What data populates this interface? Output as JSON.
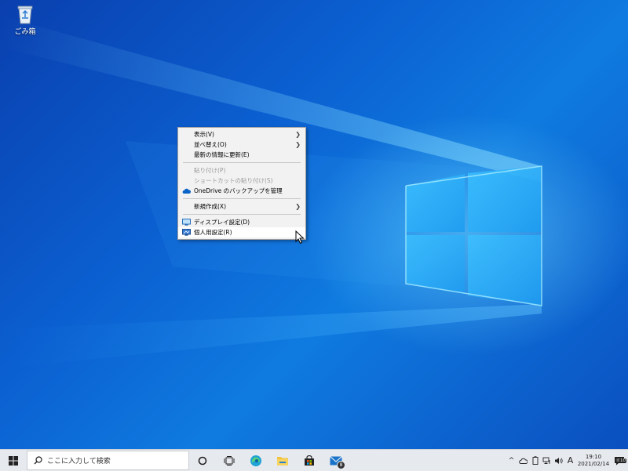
{
  "desktop": {
    "recycle_bin_label": "ごみ箱"
  },
  "context_menu": {
    "items": [
      {
        "label": "表示(V)",
        "submenu": true
      },
      {
        "label": "並べ替え(O)",
        "submenu": true
      },
      {
        "label": "最新の情報に更新(E)"
      },
      {
        "label": "貼り付け(P)",
        "disabled": true
      },
      {
        "label": "ショートカットの貼り付け(S)",
        "disabled": true
      },
      {
        "label": "OneDrive のバックアップを管理",
        "icon": "onedrive-cloud-icon"
      },
      {
        "label": "新規作成(X)",
        "submenu": true
      },
      {
        "label": "ディスプレイ設定(D)",
        "icon": "display-icon"
      },
      {
        "label": "個人用設定(R)",
        "icon": "personalize-icon",
        "highlighted": true
      }
    ]
  },
  "taskbar": {
    "search_placeholder": "ここに入力して検索",
    "mail_badge": "8",
    "ime_indicator": "A",
    "time": "19:10",
    "date": "2021/02/14",
    "notification_count": "10"
  },
  "colors": {
    "desktop_accent": "#0b5fd0",
    "taskbar": "#e6e9ee",
    "menu_bg": "#f2f2f2",
    "onedrive": "#0a64c8"
  }
}
